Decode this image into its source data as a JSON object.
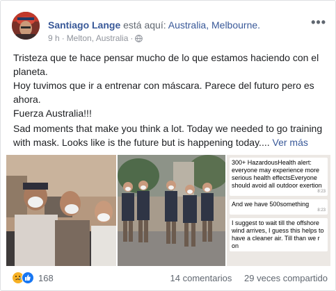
{
  "post": {
    "author": "Santiago Lange",
    "verb": "está aquí:",
    "place": "Australia, Melbourne.",
    "time": "9 h",
    "separator": "·",
    "location": "Melton, Australia",
    "separator2": "·",
    "more_label": "•••",
    "icons": {
      "privacy": "globe-icon",
      "more": "more-options-icon"
    }
  },
  "text": {
    "lines": [
      "Tristeza que te hace pensar mucho de lo que estamos haciendo con el planeta.",
      "Hoy tuvimos que ir a entrenar con máscara. Parece del futuro pero es ahora.",
      "Fuerza Australia!!!",
      "Sad moments that make you think a lot. Today we needed to go training with mask. Looks like is the future but is happening today...."
    ],
    "see_more": "Ver más"
  },
  "chat": {
    "messages": [
      {
        "text": "300+ HazardousHealth alert: everyone may experience more serious health effectsEveryone should avoid all outdoor exertion",
        "time": "8:23"
      },
      {
        "text": "And we have 500something",
        "time": "8:23"
      },
      {
        "text": "I suggest to wait till the offshore wind arrives, I guess this helps to have a cleaner air. Till than we r on",
        "time": ""
      }
    ]
  },
  "footer": {
    "reaction_count": "168",
    "comments": "14 comentarios",
    "shares": "29 veces compartido",
    "reaction_icons": [
      "sad-reaction-icon",
      "like-reaction-icon"
    ]
  },
  "colors": {
    "link": "#385898",
    "meta": "#90949c",
    "like": "#1877f2",
    "sad": "#f7b125"
  }
}
